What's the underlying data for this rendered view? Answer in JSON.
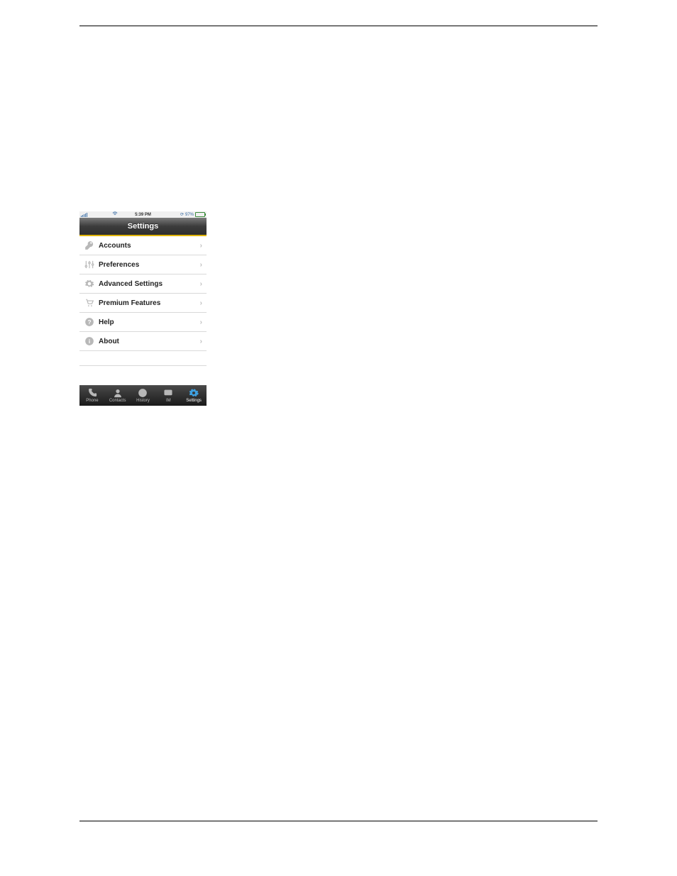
{
  "status_bar": {
    "time": "5:39 PM",
    "battery_text": "97%",
    "battery_indicator": "⚙"
  },
  "navbar": {
    "title": "Settings"
  },
  "rows": [
    {
      "icon": "key-icon",
      "label": "Accounts"
    },
    {
      "icon": "sliders-icon",
      "label": "Preferences"
    },
    {
      "icon": "gears-icon",
      "label": "Advanced Settings"
    },
    {
      "icon": "cart-icon",
      "label": "Premium Features"
    },
    {
      "icon": "help-icon",
      "label": "Help"
    },
    {
      "icon": "info-icon",
      "label": "About"
    }
  ],
  "tabs": [
    {
      "icon": "phone-icon",
      "label": "Phone",
      "active": false
    },
    {
      "icon": "contacts-icon",
      "label": "Contacts",
      "active": false
    },
    {
      "icon": "history-icon",
      "label": "History",
      "active": false
    },
    {
      "icon": "im-icon",
      "label": "IM",
      "active": false
    },
    {
      "icon": "settings-icon",
      "label": "Settings",
      "active": true
    }
  ]
}
